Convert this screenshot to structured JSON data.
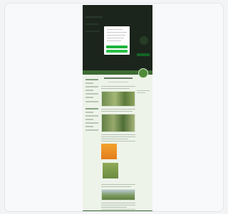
{
  "viewer": {
    "card_label": ""
  },
  "screenshot": {
    "has_cookie_modal": true,
    "modal_primary_button_color": "#1fb43c",
    "brand_color": "#3d6b33"
  }
}
